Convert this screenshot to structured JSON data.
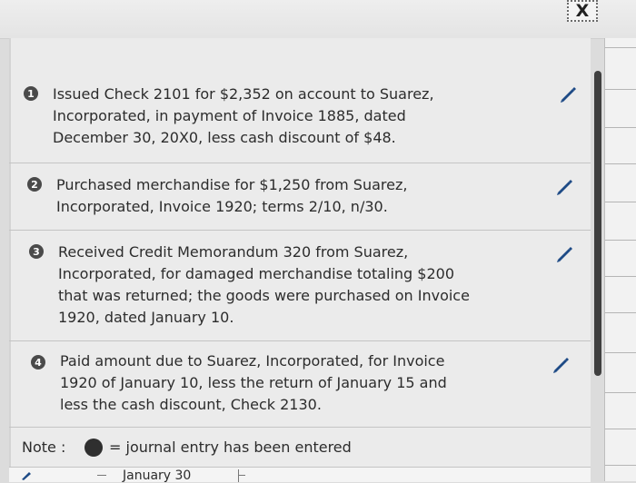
{
  "window": {
    "close_label": "X"
  },
  "entries": [
    {
      "number": "1",
      "lines": [
        "Issued Check 2101 for $2,352 on account to Suarez,",
        "Incorporated, in payment of Invoice 1885, dated",
        "December 30, 20X0, less cash discount of $48."
      ]
    },
    {
      "number": "2",
      "lines": [
        "Purchased merchandise for $1,250 from Suarez,",
        "Incorporated, Invoice 1920; terms 2/10, n/30."
      ]
    },
    {
      "number": "3",
      "lines": [
        "Received Credit Memorandum 320 from Suarez,",
        "Incorporated, for damaged merchandise totaling $200",
        "that was returned; the goods were purchased on Invoice",
        "1920, dated January 10."
      ]
    },
    {
      "number": "4",
      "lines": [
        "Paid amount due to Suarez, Incorporated, for Invoice",
        "1920 of January 10, less the return of January 15 and",
        "less the cash discount, Check 2130."
      ]
    }
  ],
  "note": {
    "label": "Note :",
    "text": "= journal entry has been entered"
  },
  "bottom": {
    "date": "January 30"
  },
  "icons": {
    "pencil": "pencil-icon",
    "close": "close-icon"
  },
  "colors": {
    "badge": "#4a4a4a",
    "pencil": "#1e4b86"
  }
}
